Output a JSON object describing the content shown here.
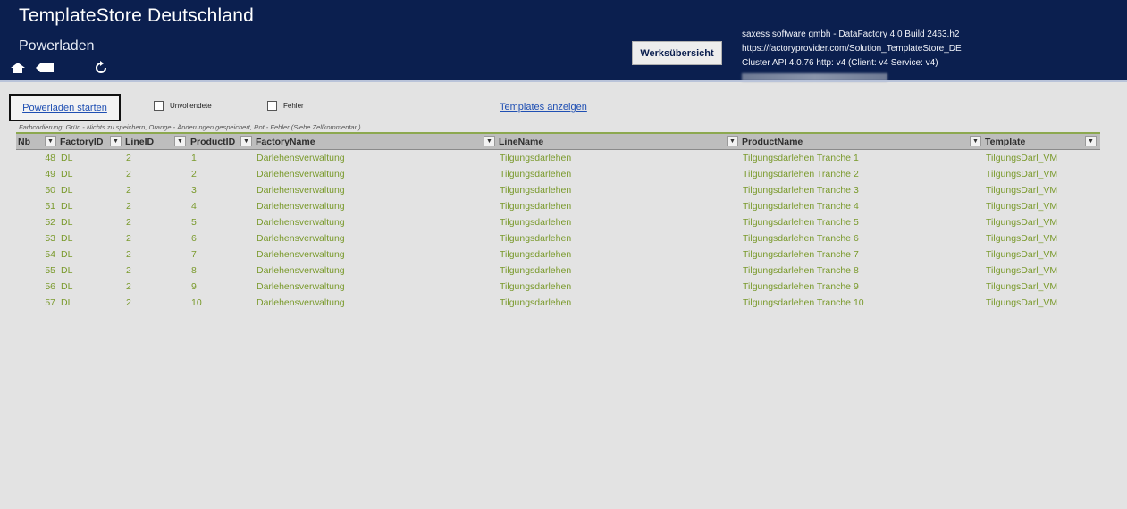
{
  "header": {
    "title": "TemplateStore Deutschland",
    "subtitle": "Powerladen",
    "werks_button": "Werksübersicht",
    "info_lines": [
      "saxess software gmbh - DataFactory 4.0 Build 2463.h2",
      "https://factoryprovider.com/Solution_TemplateStore_DE",
      "Cluster API 4.0.76 http: v4 (Client: v4 Service: v4)"
    ],
    "icons": [
      "home-icon",
      "back-tag-icon",
      "refresh-icon"
    ]
  },
  "toolbar": {
    "start_link": "Powerladen starten",
    "check_unvollendete": "Unvollendete",
    "check_fehler": "Fehler",
    "templates_link": "Templates anzeigen"
  },
  "legend": "Farbcodierung: Grün - Nichts zu speichern, Orange - Änderungen gespeichert, Rot - Fehler (Siehe Zellkommentar )",
  "colors": {
    "header_bg": "#0b1f4f",
    "row_text": "#7a9a2c",
    "link": "#1f4fb3"
  },
  "table": {
    "columns": [
      "Nb",
      "FactoryID",
      "LineID",
      "ProductID",
      "FactoryName",
      "LineName",
      "ProductName",
      "Template"
    ],
    "rows": [
      [
        "48",
        "DL",
        "2",
        "1",
        "Darlehensverwaltung",
        "Tilgungsdarlehen",
        "Tilgungsdarlehen Tranche 1",
        "TilgungsDarl_VM"
      ],
      [
        "49",
        "DL",
        "2",
        "2",
        "Darlehensverwaltung",
        "Tilgungsdarlehen",
        "Tilgungsdarlehen Tranche 2",
        "TilgungsDarl_VM"
      ],
      [
        "50",
        "DL",
        "2",
        "3",
        "Darlehensverwaltung",
        "Tilgungsdarlehen",
        "Tilgungsdarlehen Tranche 3",
        "TilgungsDarl_VM"
      ],
      [
        "51",
        "DL",
        "2",
        "4",
        "Darlehensverwaltung",
        "Tilgungsdarlehen",
        "Tilgungsdarlehen Tranche 4",
        "TilgungsDarl_VM"
      ],
      [
        "52",
        "DL",
        "2",
        "5",
        "Darlehensverwaltung",
        "Tilgungsdarlehen",
        "Tilgungsdarlehen Tranche 5",
        "TilgungsDarl_VM"
      ],
      [
        "53",
        "DL",
        "2",
        "6",
        "Darlehensverwaltung",
        "Tilgungsdarlehen",
        "Tilgungsdarlehen Tranche 6",
        "TilgungsDarl_VM"
      ],
      [
        "54",
        "DL",
        "2",
        "7",
        "Darlehensverwaltung",
        "Tilgungsdarlehen",
        "Tilgungsdarlehen Tranche 7",
        "TilgungsDarl_VM"
      ],
      [
        "55",
        "DL",
        "2",
        "8",
        "Darlehensverwaltung",
        "Tilgungsdarlehen",
        "Tilgungsdarlehen Tranche 8",
        "TilgungsDarl_VM"
      ],
      [
        "56",
        "DL",
        "2",
        "9",
        "Darlehensverwaltung",
        "Tilgungsdarlehen",
        "Tilgungsdarlehen Tranche 9",
        "TilgungsDarl_VM"
      ],
      [
        "57",
        "DL",
        "2",
        "10",
        "Darlehensverwaltung",
        "Tilgungsdarlehen",
        "Tilgungsdarlehen Tranche 10",
        "TilgungsDarl_VM"
      ]
    ]
  }
}
